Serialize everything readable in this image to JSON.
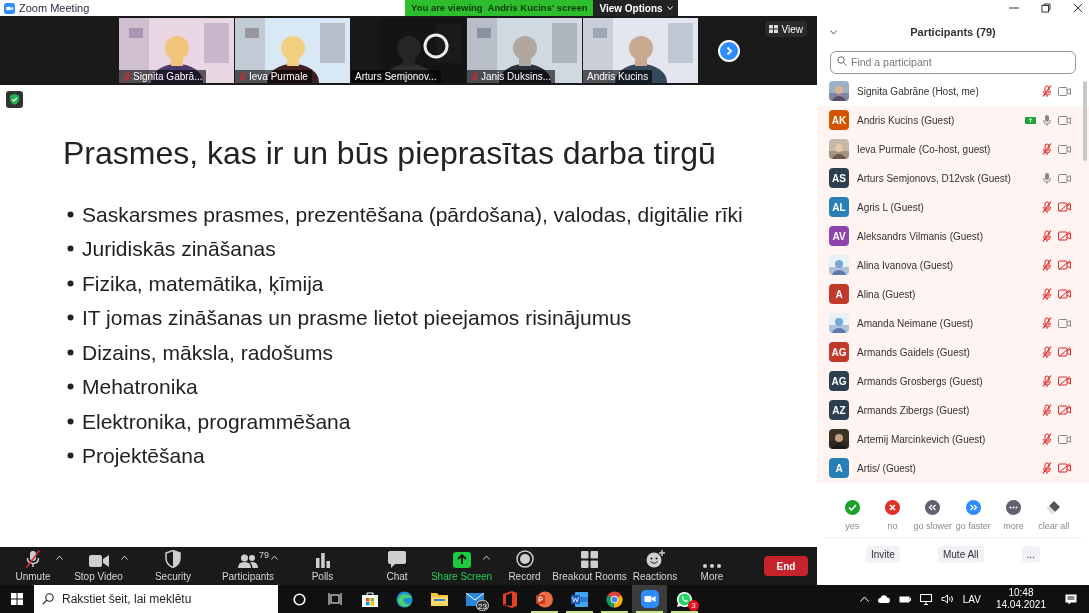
{
  "window": {
    "title": "Zoom Meeting",
    "banner": "You are viewing  Andris Kucins' screen",
    "view_options": "View Options"
  },
  "videos": [
    {
      "name": "Signita Gabrā...",
      "muted": true,
      "speaking": false
    },
    {
      "name": "Ieva Purmale",
      "muted": true,
      "speaking": false
    },
    {
      "name": "Arturs Semjonov...",
      "muted": false,
      "speaking": false
    },
    {
      "name": "Janis Duksins...",
      "muted": true,
      "speaking": false
    },
    {
      "name": "Andris Kucins",
      "muted": false,
      "speaking": true
    }
  ],
  "view_button": "View",
  "slide": {
    "title": "Prasmes, kas ir un būs pieprasītas darba tirgū",
    "bullets": [
      "Saskarsmes prasmes, prezentēšana (pārdošana), valodas, digitālie rīki",
      "Juridiskās zināšanas",
      "Fizika, matemātika, ķīmija",
      "IT jomas zināšanas un prasme lietot pieejamos risinājumus",
      "Dizains, māksla, radošums",
      "Mehatronika",
      "Elektronika, programmēšana",
      "Projektēšana"
    ]
  },
  "toolbar": [
    {
      "kind": "unmute",
      "label": "Unmute",
      "menu": true
    },
    {
      "kind": "video",
      "label": "Stop Video",
      "menu": true
    },
    {
      "kind": "security",
      "label": "Security",
      "menu": false
    },
    {
      "kind": "participants",
      "label": "Participants",
      "count": "79",
      "menu": true
    },
    {
      "kind": "polls",
      "label": "Polls",
      "menu": false
    },
    {
      "kind": "chat",
      "label": "Chat",
      "menu": false
    },
    {
      "kind": "share",
      "label": "Share Screen",
      "menu": true
    },
    {
      "kind": "record",
      "label": "Record",
      "menu": false
    },
    {
      "kind": "breakout",
      "label": "Breakout Rooms",
      "menu": false
    },
    {
      "kind": "reactions",
      "label": "Reactions",
      "menu": false
    },
    {
      "kind": "more",
      "label": "More",
      "menu": false
    }
  ],
  "end_button": "End",
  "participants_panel": {
    "title": "Participants (79)",
    "search": {
      "placeholder": "Find a participant"
    },
    "participants": [
      {
        "name": "Signita Gabrāne (Host, me)",
        "muted": true,
        "video": true,
        "sharing": false,
        "highlighted": false
      },
      {
        "name": "Andris Kucins (Guest)",
        "avatar": {
          "kind": "initials",
          "initials": "AK",
          "color": "#d35400"
        },
        "muted": false,
        "video": true,
        "sharing": true,
        "highlighted": true
      },
      {
        "name": "Ieva Purmale (Co-host, guest)",
        "muted": true,
        "video": true,
        "sharing": false,
        "highlighted": true
      },
      {
        "name": "Arturs Semjonovs, D12vsk (Guest)",
        "avatar": {
          "kind": "initials",
          "initials": "AS",
          "color": "#2c3e50"
        },
        "muted": false,
        "video": true,
        "sharing": false,
        "highlighted": true
      },
      {
        "name": "Agris L (Guest)",
        "avatar": {
          "kind": "initials",
          "initials": "AL",
          "color": "#2980b9"
        },
        "muted": true,
        "video": false,
        "sharing": false,
        "highlighted": true
      },
      {
        "name": "Aleksandrs Vilmanis (Guest)",
        "avatar": {
          "kind": "initials",
          "initials": "AV",
          "color": "#8e44ad"
        },
        "muted": true,
        "video": false,
        "sharing": false,
        "highlighted": true
      },
      {
        "name": "Alina Ivanova (Guest)",
        "muted": true,
        "video": false,
        "sharing": false,
        "highlighted": true
      },
      {
        "name": "Alina (Guest)",
        "avatar": {
          "kind": "initials",
          "initials": "A",
          "color": "#c0392b"
        },
        "muted": true,
        "video": false,
        "sharing": false,
        "highlighted": true
      },
      {
        "name": "Amanda Neimane (Guest)",
        "muted": true,
        "video": true,
        "sharing": false,
        "highlighted": true
      },
      {
        "name": "Armands Gaidels (Guest)",
        "avatar": {
          "kind": "initials",
          "initials": "AG",
          "color": "#c0392b"
        },
        "muted": true,
        "video": false,
        "sharing": false,
        "highlighted": true
      },
      {
        "name": "Armands Grosbergs (Guest)",
        "avatar": {
          "kind": "initials",
          "initials": "AG",
          "color": "#2c3e50"
        },
        "muted": true,
        "video": false,
        "sharing": false,
        "highlighted": true
      },
      {
        "name": "Armands Zibergs (Guest)",
        "avatar": {
          "kind": "initials",
          "initials": "AZ",
          "color": "#2c3e50"
        },
        "muted": true,
        "video": false,
        "sharing": false,
        "highlighted": true
      },
      {
        "name": "Artemij Marcinkevich (Guest)",
        "muted": true,
        "video": true,
        "sharing": false,
        "highlighted": true
      },
      {
        "name": "Artis/ (Guest)",
        "avatar": {
          "kind": "initials",
          "initials": "A",
          "color": "#2980b9"
        },
        "muted": true,
        "video": false,
        "sharing": false,
        "highlighted": true
      }
    ],
    "reactions": [
      {
        "kind": "yes",
        "label": "yes"
      },
      {
        "kind": "no",
        "label": "no"
      },
      {
        "kind": "slower",
        "label": "go slower"
      },
      {
        "kind": "faster",
        "label": "go faster"
      },
      {
        "kind": "more",
        "label": "more"
      },
      {
        "kind": "clear",
        "label": "clear all"
      }
    ],
    "buttons": [
      "Invite",
      "Mute All",
      "..."
    ]
  },
  "taskbar": {
    "search": {
      "placeholder": "Rakstiet šeit, lai meklētu"
    },
    "apps": [
      {
        "kind": "cortana",
        "running": false,
        "active": false
      },
      {
        "kind": "taskview",
        "running": false,
        "active": false
      },
      {
        "kind": "store",
        "running": false,
        "active": false
      },
      {
        "kind": "edge",
        "running": false,
        "active": false
      },
      {
        "kind": "explorer",
        "running": false,
        "active": false
      },
      {
        "kind": "mail",
        "badge": "23",
        "running": false,
        "active": false
      },
      {
        "kind": "office",
        "running": false,
        "active": false
      },
      {
        "kind": "powerpoint",
        "running": true,
        "active": false
      },
      {
        "kind": "word",
        "running": true,
        "active": false
      },
      {
        "kind": "chrome",
        "running": true,
        "active": false
      },
      {
        "kind": "zoom",
        "running": true,
        "active": true
      },
      {
        "kind": "whatsapp",
        "badge": "3",
        "running": true,
        "active": false
      }
    ],
    "language": "LAV",
    "time": "10:48",
    "date": "14.04.2021"
  }
}
